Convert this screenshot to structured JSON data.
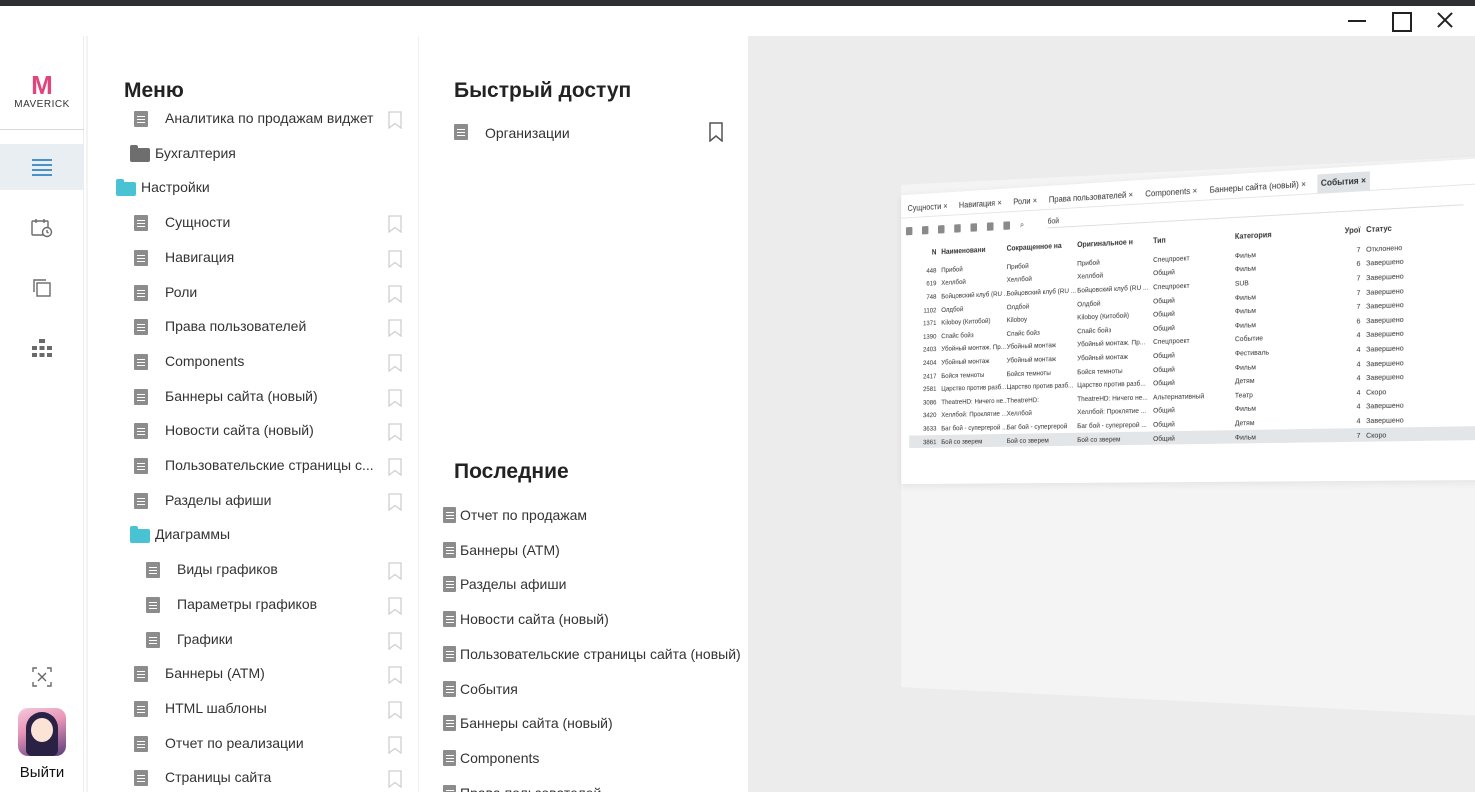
{
  "window": {
    "minimize": "minimize",
    "maximize": "maximize",
    "close": "close"
  },
  "rail": {
    "logo_text": "MAVERICK",
    "logo_letter": "M",
    "items": [
      "menu-icon",
      "calendar-clock-icon",
      "windows-icon",
      "org-chart-icon"
    ],
    "bottom_icon": "selection-clear-icon",
    "exit_label": "Выйти"
  },
  "menu": {
    "title": "Меню",
    "items": [
      {
        "label": "Аналитика по продажам виджет",
        "type": "doc",
        "level": 2
      },
      {
        "label": "Бухгалтерия",
        "type": "folder",
        "level": 1
      },
      {
        "label": "Настройки",
        "type": "folder-open",
        "level": 0
      },
      {
        "label": "Сущности",
        "type": "doc",
        "level": 2
      },
      {
        "label": "Навигация",
        "type": "doc",
        "level": 2
      },
      {
        "label": "Роли",
        "type": "doc",
        "level": 2
      },
      {
        "label": "Права пользователей",
        "type": "doc",
        "level": 2
      },
      {
        "label": "Components",
        "type": "doc",
        "level": 2
      },
      {
        "label": "Баннеры сайта (новый)",
        "type": "doc",
        "level": 2
      },
      {
        "label": "Новости сайта (новый)",
        "type": "doc",
        "level": 2
      },
      {
        "label": "Пользовательские страницы с...",
        "type": "doc",
        "level": 2
      },
      {
        "label": "Разделы афиши",
        "type": "doc",
        "level": 2
      },
      {
        "label": "Диаграммы",
        "type": "folder-open",
        "level": 1
      },
      {
        "label": "Виды графиков",
        "type": "doc",
        "level": 3
      },
      {
        "label": "Параметры графиков",
        "type": "doc",
        "level": 3
      },
      {
        "label": "Графики",
        "type": "doc",
        "level": 3
      },
      {
        "label": "Баннеры (ATM)",
        "type": "doc",
        "level": 2
      },
      {
        "label": "HTML шаблоны",
        "type": "doc",
        "level": 2
      },
      {
        "label": "Отчет по реализации",
        "type": "doc",
        "level": 2
      },
      {
        "label": "Страницы сайта",
        "type": "doc",
        "level": 2
      }
    ]
  },
  "quick": {
    "title": "Быстрый доступ",
    "items": [
      {
        "label": "Организации"
      }
    ]
  },
  "recent": {
    "title": "Последние",
    "items": [
      "Отчет по продажам",
      "Баннеры (ATM)",
      "Разделы афиши",
      "Новости сайта (новый)",
      "Пользовательские страницы сайта (новый)",
      "События",
      "Баннеры сайта (новый)",
      "Components",
      "Права пользователей"
    ]
  },
  "preview": {
    "tabs": [
      "Сущности ×",
      "Навигация ×",
      "Роли ×",
      "Права пользователей ×",
      "Components ×",
      "Баннеры сайта (новый) ×",
      "События ×"
    ],
    "active_tab": 6,
    "search_value": "бой",
    "columns": [
      "N",
      "Наименовани",
      "Сокращенное на",
      "Оригинальное н",
      "Тип",
      "Категория",
      "Урої",
      "Статус"
    ],
    "rows": [
      [
        "448",
        "Прибой",
        "Прибой",
        "Прибой",
        "Спецпроект",
        "Фильм",
        "7",
        "Отклонено"
      ],
      [
        "619",
        "Хеллбой",
        "Хеллбой",
        "Хеллбой",
        "Общий",
        "Фильм",
        "6",
        "Завершено"
      ],
      [
        "748",
        "Бойцовский клуб (RU ...",
        "Бойцовский клуб (RU ...",
        "Бойцовский клуб (RU ...",
        "Спецпроект",
        "SUB",
        "7",
        "Завершено"
      ],
      [
        "1102",
        "Олдбой",
        "Олдбой",
        "Олдбой",
        "Общий",
        "Фильм",
        "7",
        "Завершено"
      ],
      [
        "1371",
        "Kiloboy (Китобой)",
        "Kiloboy",
        "Kiloboy (Китобой)",
        "Общий",
        "Фильм",
        "7",
        "Завершено"
      ],
      [
        "1390",
        "Спайс бойз",
        "Спайс бойз",
        "Спайс бойз",
        "Общий",
        "Фильм",
        "6",
        "Завершено"
      ],
      [
        "2403",
        "Убойный монтаж. Пр...",
        "Убойный монтаж",
        "Убойный монтаж. Пр...",
        "Спецпроект",
        "Событие",
        "4",
        "Завершено"
      ],
      [
        "2404",
        "Убойный монтаж",
        "Убойный монтаж",
        "Убойный монтаж",
        "Общий",
        "Фестиваль",
        "4",
        "Завершено"
      ],
      [
        "2417",
        "Бойся темноты",
        "Бойся темноты",
        "Бойся темноты",
        "Общий",
        "Фильм",
        "4",
        "Завершено"
      ],
      [
        "2581",
        "Царство против разб...",
        "Царство против разб...",
        "Царство против разб...",
        "Общий",
        "Детям",
        "4",
        "Завершено"
      ],
      [
        "3086",
        "TheatreHD: Ничего не...",
        "TheatreHD:",
        "TheatreHD: Ничего не...",
        "Альтернативный",
        "Театр",
        "4",
        "Скоро"
      ],
      [
        "3420",
        "Хеллбой: Проклятие ...",
        "Хеллбой",
        "Хеллбой: Проклятие ...",
        "Общий",
        "Фильм",
        "4",
        "Завершено"
      ],
      [
        "3633",
        "Баг бой - супергерой ...",
        "Баг бой - супергерой",
        "Баг бой - супергерой ...",
        "Общий",
        "Детям",
        "4",
        "Завершено"
      ],
      [
        "3861",
        "Бой со зверем",
        "Бой со зверем",
        "Бой со зверем",
        "Общий",
        "Фильм",
        "7",
        "Скоро"
      ]
    ],
    "selected_row": 13
  }
}
